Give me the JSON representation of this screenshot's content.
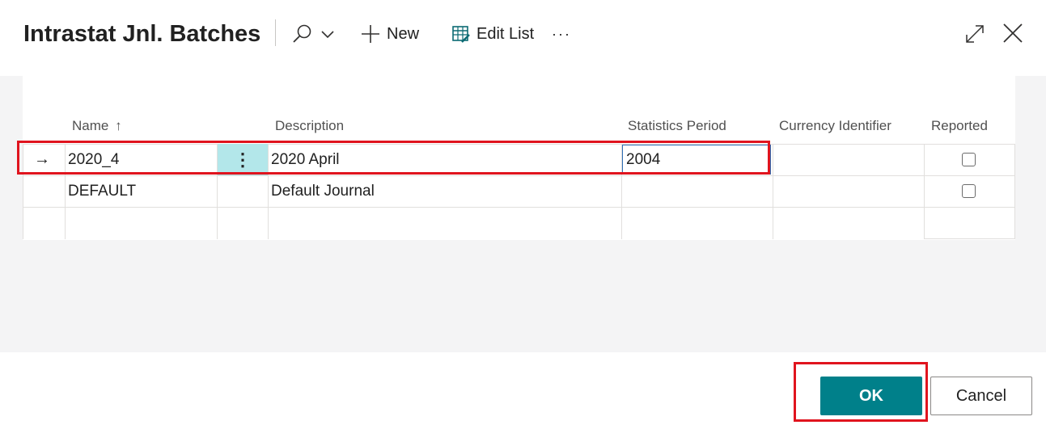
{
  "header": {
    "title": "Intrastat Jnl. Batches",
    "new_label": "New",
    "edit_list_label": "Edit List",
    "more_label": "···"
  },
  "grid": {
    "columns": {
      "name": "Name",
      "sort_indicator": "↑",
      "description": "Description",
      "statistics_period": "Statistics Period",
      "currency_identifier": "Currency Identifier",
      "reported": "Reported"
    },
    "rows": [
      {
        "name": "2020_4",
        "description": "2020 April",
        "statistics_period": "2004",
        "currency_identifier": "",
        "reported": false,
        "selected": true
      },
      {
        "name": "DEFAULT",
        "description": "Default Journal",
        "statistics_period": "",
        "currency_identifier": "",
        "reported": false,
        "selected": false
      }
    ],
    "row_marker": "→",
    "row_menu": "⋮"
  },
  "footer": {
    "ok_label": "OK",
    "cancel_label": "Cancel"
  },
  "colors": {
    "accent": "#00808a",
    "highlight": "#e0141e",
    "row_menu_bg": "#b3e7ea"
  }
}
